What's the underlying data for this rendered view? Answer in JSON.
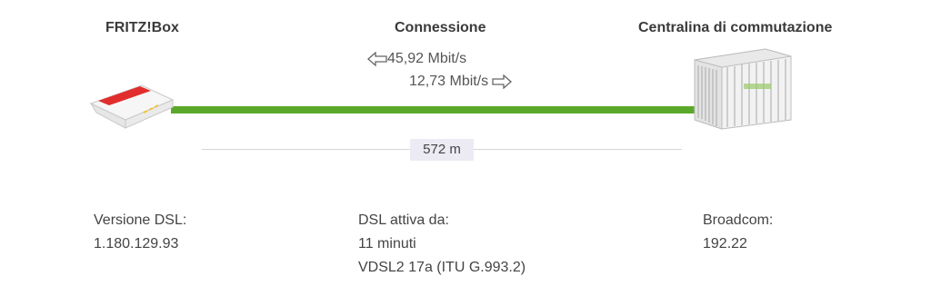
{
  "headers": {
    "fritzbox": "FRITZ!Box",
    "connection": "Connessione",
    "exchange": "Centralina di commutazione"
  },
  "rates": {
    "downstream": "45,92 Mbit/s",
    "upstream": "12,73 Mbit/s"
  },
  "distance": "572 m",
  "line_color": "#5aa82a",
  "icons": {
    "router": "fritzbox-router-icon",
    "exchange": "exchange-cabinet-icon",
    "down_arrow": "arrow-left-icon",
    "up_arrow": "arrow-right-icon"
  },
  "info": {
    "left": {
      "label": "Versione DSL:",
      "value": "1.180.129.93"
    },
    "middle": {
      "label": "DSL attiva da:",
      "value": "11 minuti",
      "extra": "VDSL2 17a (ITU G.993.2)"
    },
    "right": {
      "label": "Broadcom:",
      "value": "192.22"
    }
  }
}
